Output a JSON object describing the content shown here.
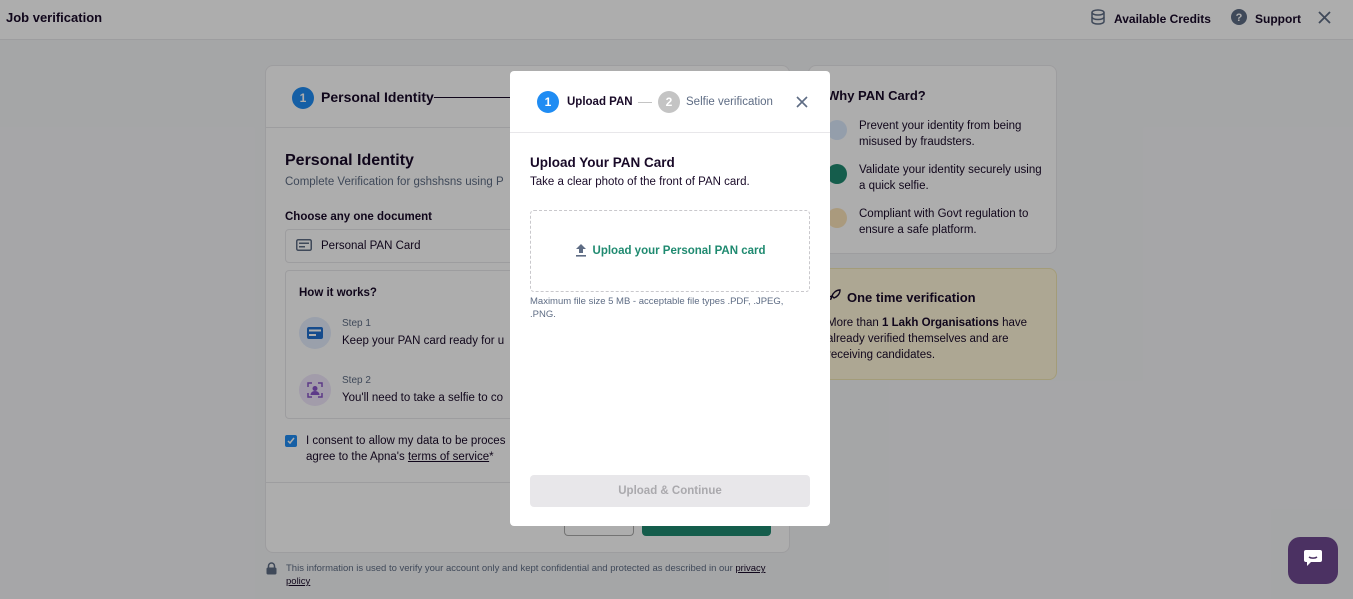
{
  "header": {
    "title": "Job verification",
    "credits_label": "Available Credits",
    "support_label": "Support"
  },
  "base": {
    "step1_num": "1",
    "step1_label": "Personal Identity",
    "pi_title": "Personal Identity",
    "pi_subtitle": "Complete Verification for gshshsns using P",
    "choose_label": "Choose any one document",
    "select_value": "Personal PAN Card",
    "hiw_title": "How it works?",
    "step_a_key": "Step 1",
    "step_a_val": "Keep your PAN card ready for u",
    "step_b_key": "Step 2",
    "step_b_val": "You'll need to take a selfie to co",
    "consent_line1": "I consent to allow my data to be proces",
    "consent_line2_prefix": "agree to the Apna's ",
    "consent_link": "terms of service",
    "consent_suffix": "*",
    "privacy_text": "This information is used to verify your account only and kept confidential and protected as described in our ",
    "privacy_link": "privacy policy"
  },
  "why_card": {
    "title": "Why PAN Card?",
    "items": [
      {
        "text": "Prevent your identity from being misused by fraudsters.",
        "color": "#1f8cf3"
      },
      {
        "text": "Validate your identity securely using a quick selfie.",
        "color": "#1f8a70"
      },
      {
        "text": "Compliant with Govt regulation to ensure a safe platform.",
        "color": "#e59e2b"
      }
    ]
  },
  "otv_card": {
    "title": "One time verification",
    "body_prefix": "More than ",
    "body_bold": "1 Lakh Organisations",
    "body_suffix": " have already verified themselves and are receiving candidates."
  },
  "modal": {
    "step1_num": "1",
    "step1_label": "Upload PAN",
    "step2_num": "2",
    "step2_label": "Selfie verification",
    "title": "Upload Your PAN Card",
    "subtitle": "Take a clear photo of the front of PAN card.",
    "upload_label": "Upload your Personal PAN card",
    "hint": "Maximum file size 5 MB - acceptable file types .PDF, .JPEG, .PNG.",
    "continue_label": "Upload & Continue"
  },
  "colors": {
    "accent": "#1f8cf3",
    "brand_green": "#1f8a70",
    "chat": "#4b3162"
  }
}
